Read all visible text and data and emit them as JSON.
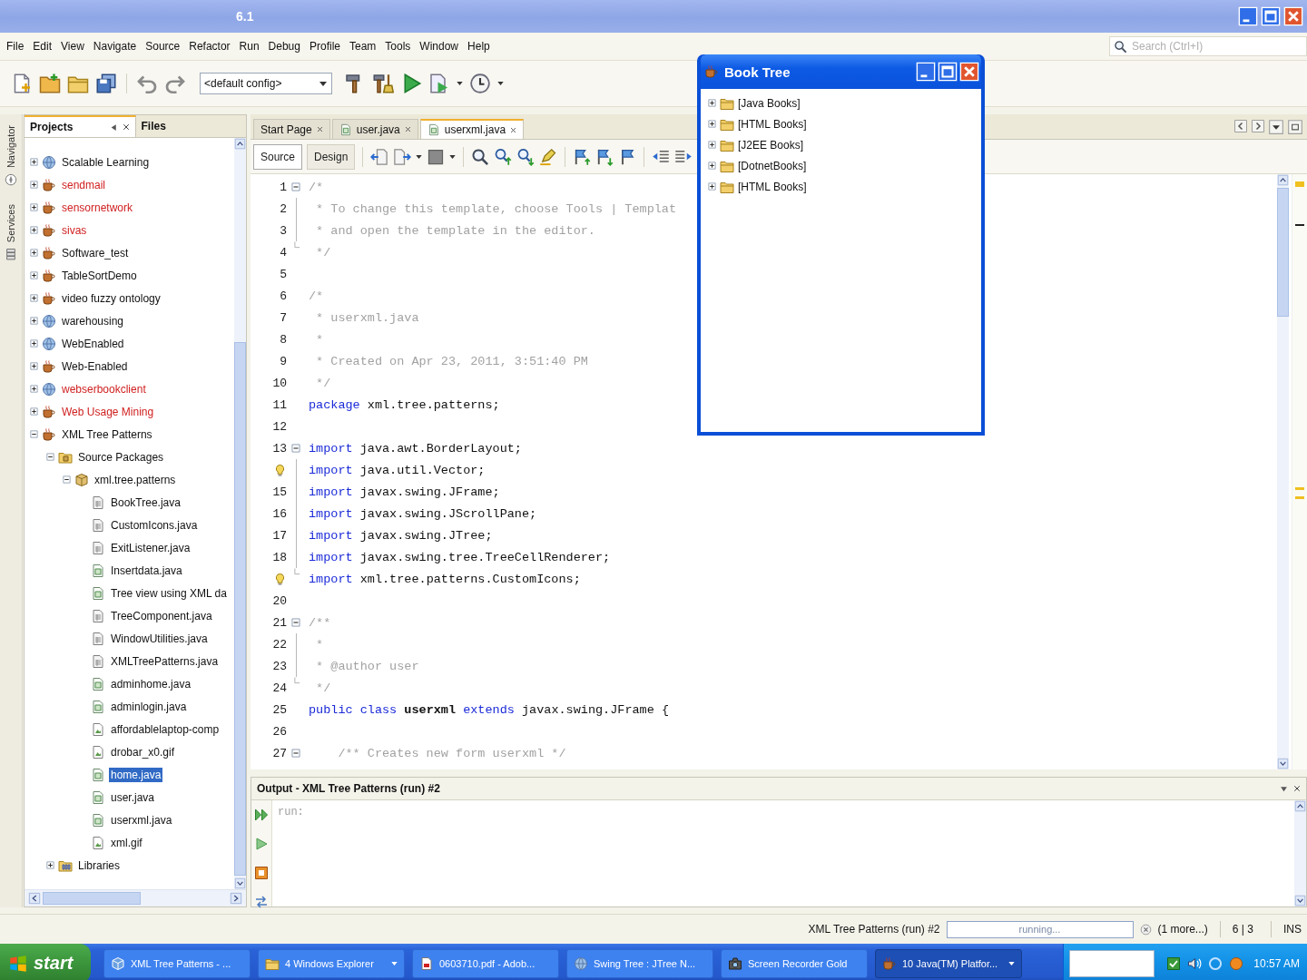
{
  "window": {
    "title": "6.1"
  },
  "menu": [
    "File",
    "Edit",
    "View",
    "Navigate",
    "Source",
    "Refactor",
    "Run",
    "Debug",
    "Profile",
    "Team",
    "Tools",
    "Window",
    "Help"
  ],
  "toolbar": {
    "config": "<default config>"
  },
  "search": {
    "placeholder": "Search (Ctrl+I)"
  },
  "side_tabs": [
    "Navigator",
    "Services"
  ],
  "project_tabs": [
    {
      "label": "Projects",
      "selected": true
    },
    {
      "label": "Files",
      "selected": false
    }
  ],
  "project_tree": [
    {
      "label": "Scalable Learning",
      "kind": "web",
      "error": false,
      "expanded": false,
      "selected": false
    },
    {
      "label": "sendmail",
      "kind": "java",
      "error": true,
      "expanded": false,
      "selected": false
    },
    {
      "label": "sensornetwork",
      "kind": "java",
      "error": true,
      "expanded": false,
      "selected": false
    },
    {
      "label": "sivas",
      "kind": "java",
      "error": true,
      "expanded": false,
      "selected": false
    },
    {
      "label": "Software_test",
      "kind": "java",
      "error": false,
      "expanded": false,
      "selected": false
    },
    {
      "label": "TableSortDemo",
      "kind": "java",
      "error": false,
      "expanded": false,
      "selected": false
    },
    {
      "label": "video fuzzy ontology",
      "kind": "java",
      "error": false,
      "expanded": false,
      "selected": false
    },
    {
      "label": "warehousing",
      "kind": "web",
      "error": false,
      "expanded": false,
      "selected": false
    },
    {
      "label": "WebEnabled",
      "kind": "web",
      "error": false,
      "expanded": false,
      "selected": false
    },
    {
      "label": "Web-Enabled",
      "kind": "java",
      "error": false,
      "expanded": false,
      "selected": false
    },
    {
      "label": "webserbookclient",
      "kind": "web",
      "error": true,
      "expanded": false,
      "selected": false
    },
    {
      "label": "Web Usage Mining",
      "kind": "java",
      "error": true,
      "expanded": false,
      "selected": false
    },
    {
      "label": "XML Tree Patterns",
      "kind": "java",
      "error": false,
      "expanded": true,
      "selected": false,
      "children": [
        {
          "label": "Source Packages",
          "kind": "sources",
          "expanded": true,
          "selected": false,
          "children": [
            {
              "label": "xml.tree.patterns",
              "kind": "package",
              "expanded": true,
              "selected": false,
              "children": [
                {
                  "label": "BookTree.java",
                  "kind": "class",
                  "selected": false
                },
                {
                  "label": "CustomIcons.java",
                  "kind": "class",
                  "selected": false
                },
                {
                  "label": "ExitListener.java",
                  "kind": "class",
                  "selected": false
                },
                {
                  "label": "Insertdata.java",
                  "kind": "form",
                  "selected": false
                },
                {
                  "label": "Tree view using XML da",
                  "kind": "form",
                  "selected": false
                },
                {
                  "label": "TreeComponent.java",
                  "kind": "class",
                  "selected": false
                },
                {
                  "label": "WindowUtilities.java",
                  "kind": "class",
                  "selected": false
                },
                {
                  "label": "XMLTreePatterns.java",
                  "kind": "class",
                  "selected": false
                },
                {
                  "label": "adminhome.java",
                  "kind": "form",
                  "selected": false
                },
                {
                  "label": "adminlogin.java",
                  "kind": "form",
                  "selected": false
                },
                {
                  "label": "affordablelaptop-comp",
                  "kind": "image",
                  "selected": false
                },
                {
                  "label": "drobar_x0.gif",
                  "kind": "image",
                  "selected": false
                },
                {
                  "label": "home.java",
                  "kind": "form",
                  "selected": true
                },
                {
                  "label": "user.java",
                  "kind": "form",
                  "selected": false
                },
                {
                  "label": "userxml.java",
                  "kind": "form",
                  "selected": false
                },
                {
                  "label": "xml.gif",
                  "kind": "image",
                  "selected": false
                }
              ]
            }
          ]
        },
        {
          "label": "Libraries",
          "kind": "libraries",
          "expanded": false,
          "selected": false
        }
      ]
    }
  ],
  "editor_tabs": [
    {
      "label": "Start Page",
      "kind": "page",
      "selected": false
    },
    {
      "label": "user.java",
      "kind": "file",
      "selected": false
    },
    {
      "label": "userxml.java",
      "kind": "file",
      "selected": true
    }
  ],
  "view_buttons": [
    {
      "label": "Source",
      "selected": true
    },
    {
      "label": "Design",
      "selected": false
    }
  ],
  "code_lines": [
    {
      "number": "1",
      "hint": false,
      "fold_start": true,
      "fold_end": false,
      "parts": [
        {
          "kind": "comment",
          "text": "/*"
        }
      ]
    },
    {
      "number": "2",
      "hint": false,
      "fold_start": false,
      "fold_end": false,
      "parts": [
        {
          "kind": "comment",
          "text": " * To change this template, choose Tools | Templat"
        }
      ]
    },
    {
      "number": "3",
      "hint": false,
      "fold_start": false,
      "fold_end": false,
      "parts": [
        {
          "kind": "comment",
          "text": " * and open the template in the editor."
        }
      ]
    },
    {
      "number": "4",
      "hint": false,
      "fold_start": false,
      "fold_end": true,
      "parts": [
        {
          "kind": "comment",
          "text": " */"
        }
      ]
    },
    {
      "number": "5",
      "hint": false,
      "fold_start": false,
      "fold_end": false
    },
    {
      "number": "6",
      "hint": false,
      "fold_start": false,
      "fold_end": false,
      "parts": [
        {
          "kind": "comment",
          "text": "/*"
        }
      ]
    },
    {
      "number": "7",
      "hint": false,
      "fold_start": false,
      "fold_end": false,
      "parts": [
        {
          "kind": "comment",
          "text": " * userxml.java"
        }
      ]
    },
    {
      "number": "8",
      "hint": false,
      "fold_start": false,
      "fold_end": false,
      "parts": [
        {
          "kind": "comment",
          "text": " *"
        }
      ]
    },
    {
      "number": "9",
      "hint": false,
      "fold_start": false,
      "fold_end": false,
      "parts": [
        {
          "kind": "comment",
          "text": " * Created on Apr 23, 2011, 3:51:40 PM"
        }
      ]
    },
    {
      "number": "10",
      "hint": false,
      "fold_start": false,
      "fold_end": false,
      "parts": [
        {
          "kind": "comment",
          "text": " */"
        }
      ]
    },
    {
      "number": "11",
      "hint": false,
      "fold_start": false,
      "fold_end": false,
      "parts": [
        {
          "kind": "keyword",
          "text": "package"
        },
        {
          "kind": "plain",
          "text": "xml.tree.patterns;"
        }
      ]
    },
    {
      "number": "12",
      "hint": false,
      "fold_start": false,
      "fold_end": false
    },
    {
      "number": "13",
      "hint": false,
      "fold_start": true,
      "fold_end": false,
      "parts": [
        {
          "kind": "keyword",
          "text": "import"
        },
        {
          "kind": "plain",
          "text": "java.awt.BorderLayout;"
        }
      ]
    },
    {
      "hint": true,
      "fold_start": false,
      "fold_end": false,
      "parts": [
        {
          "kind": "keyword",
          "text": "import"
        },
        {
          "kind": "plain",
          "text": "java.util.Vector;"
        }
      ]
    },
    {
      "number": "15",
      "hint": false,
      "fold_start": false,
      "fold_end": false,
      "parts": [
        {
          "kind": "keyword",
          "text": "import"
        },
        {
          "kind": "plain",
          "text": "javax.swing.JFrame;"
        }
      ]
    },
    {
      "number": "16",
      "hint": false,
      "fold_start": false,
      "fold_end": false,
      "parts": [
        {
          "kind": "keyword",
          "text": "import"
        },
        {
          "kind": "plain",
          "text": "javax.swing.JScrollPane;"
        }
      ]
    },
    {
      "number": "17",
      "hint": false,
      "fold_start": false,
      "fold_end": false,
      "parts": [
        {
          "kind": "keyword",
          "text": "import"
        },
        {
          "kind": "plain",
          "text": "javax.swing.JTree;"
        }
      ]
    },
    {
      "number": "18",
      "hint": false,
      "fold_start": false,
      "fold_end": false,
      "parts": [
        {
          "kind": "keyword",
          "text": "import"
        },
        {
          "kind": "plain",
          "text": "javax.swing.tree.TreeCellRenderer;"
        }
      ]
    },
    {
      "hint": true,
      "fold_start": false,
      "fold_end": true,
      "parts": [
        {
          "kind": "keyword",
          "text": "import"
        },
        {
          "kind": "plain",
          "text": "xml.tree.patterns.CustomIcons;"
        }
      ]
    },
    {
      "number": "20",
      "hint": false,
      "fold_start": false,
      "fold_end": false
    },
    {
      "number": "21",
      "hint": false,
      "fold_start": true,
      "fold_end": false,
      "parts": [
        {
          "kind": "comment",
          "text": "/**"
        }
      ]
    },
    {
      "number": "22",
      "hint": false,
      "fold_start": false,
      "fold_end": false,
      "parts": [
        {
          "kind": "comment",
          "text": " *"
        }
      ]
    },
    {
      "number": "23",
      "hint": false,
      "fold_start": false,
      "fold_end": false,
      "parts": [
        {
          "kind": "comment",
          "text": " * @author user"
        }
      ]
    },
    {
      "number": "24",
      "hint": false,
      "fold_start": false,
      "fold_end": true,
      "parts": [
        {
          "kind": "comment",
          "text": " */"
        }
      ]
    },
    {
      "number": "25",
      "hint": false,
      "fold_start": false,
      "fold_end": false,
      "parts": [
        {
          "kind": "keyword",
          "text": "public class"
        },
        {
          "kind": "name",
          "text": "userxml"
        },
        {
          "kind": "keyword",
          "text": "extends"
        },
        {
          "kind": "plain",
          "text": "javax.swing.JFrame {"
        }
      ]
    },
    {
      "number": "26",
      "hint": false,
      "fold_start": false,
      "fold_end": false
    },
    {
      "number": "27",
      "hint": false,
      "fold_start": true,
      "fold_end": false,
      "parts": [
        {
          "kind": "comment",
          "text": "    /** Creates new form userxml */"
        }
      ]
    }
  ],
  "book_tree_window": {
    "title": "Book Tree",
    "items": [
      {
        "label": "[Java Books]",
        "expanded": false
      },
      {
        "label": "[HTML Books]",
        "expanded": false
      },
      {
        "label": "[J2EE Books]",
        "expanded": false
      },
      {
        "label": "[DotnetBooks]",
        "expanded": false
      },
      {
        "label": "[HTML Books]",
        "expanded": false
      }
    ]
  },
  "output": {
    "title": "Output - XML Tree Patterns (run) #2",
    "lines": [
      "run:"
    ]
  },
  "status_bar": {
    "task": "XML Tree Patterns (run) #2",
    "progress": "running...",
    "more": "(1 more...)",
    "position": "6 | 3",
    "mode": "INS"
  },
  "taskbar": {
    "start": "start",
    "items": [
      {
        "label": "XML Tree Patterns - ...",
        "kind": "netbeans",
        "grouped": false,
        "selected": false
      },
      {
        "label": "4 Windows Explorer",
        "kind": "explorer",
        "grouped": true,
        "selected": false
      },
      {
        "label": "0603710.pdf - Adob...",
        "kind": "pdf",
        "grouped": false,
        "selected": false
      },
      {
        "label": "Swing Tree : JTree N...",
        "kind": "browser",
        "grouped": false,
        "selected": false
      },
      {
        "label": "Screen Recorder Gold",
        "kind": "recorder",
        "grouped": false,
        "selected": false
      },
      {
        "label": "10 Java(TM) Platfor...",
        "kind": "java",
        "grouped": true,
        "selected": true
      }
    ],
    "clock": "10:57 AM"
  }
}
